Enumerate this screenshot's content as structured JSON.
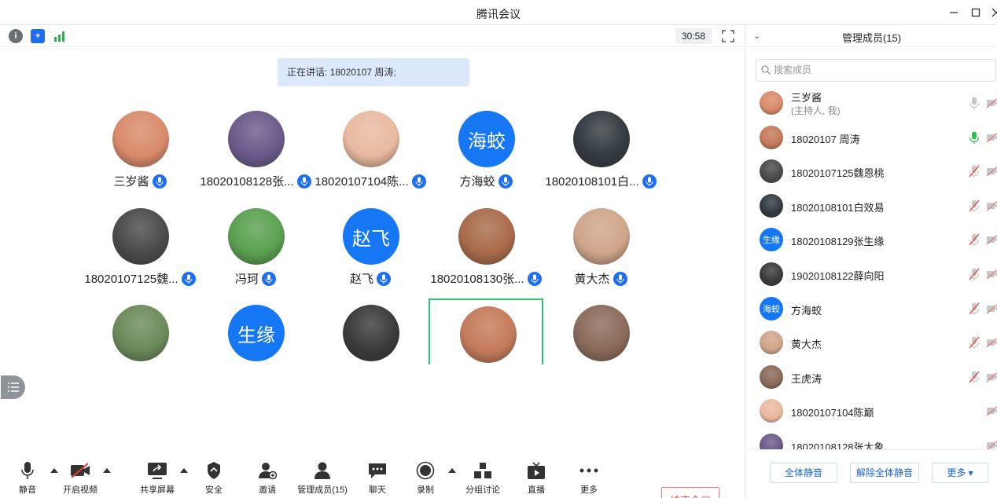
{
  "window": {
    "title": "腾讯会议"
  },
  "topbar": {
    "timer": "30:58"
  },
  "speaking": {
    "text": "正在讲话: 18020107  周涛;"
  },
  "tiles": [
    {
      "name": "三岁酱",
      "avatar": "photo",
      "color": "#d98a6a"
    },
    {
      "name": "18020108128张...",
      "avatar": "photo",
      "color": "#6a5a8a"
    },
    {
      "name": "18020107104陈...",
      "avatar": "photo",
      "color": "#e8b9a0"
    },
    {
      "name": "方海蛟",
      "avatar": "text",
      "avatar_text": "海蛟",
      "color": "#1677f5"
    },
    {
      "name": "18020108101白...",
      "avatar": "photo",
      "color": "#333a3f"
    },
    {
      "name": "18020107125魏...",
      "avatar": "photo",
      "color": "#4a4a4a"
    },
    {
      "name": "冯珂",
      "avatar": "photo",
      "color": "#5aa050"
    },
    {
      "name": "赵飞",
      "avatar": "text",
      "avatar_text": "赵飞",
      "color": "#1677f5"
    },
    {
      "name": "18020108130张...",
      "avatar": "photo",
      "color": "#a86a4a"
    },
    {
      "name": "黄大杰",
      "avatar": "photo",
      "color": "#cfa58a"
    },
    {
      "name": "",
      "avatar": "photo",
      "color": "#6a8a5a"
    },
    {
      "name": "",
      "avatar": "text",
      "avatar_text": "生缘",
      "color": "#1677f5"
    },
    {
      "name": "",
      "avatar": "photo",
      "color": "#3a3a3a"
    },
    {
      "name": "",
      "avatar": "photo",
      "color": "#c47a5a"
    },
    {
      "name": "",
      "avatar": "photo",
      "color": "#8a6a5a"
    }
  ],
  "toolbar": {
    "mute": "静音",
    "video": "开启视频",
    "share": "共享屏幕",
    "security": "安全",
    "invite": "邀请",
    "members": "管理成员(15)",
    "chat": "聊天",
    "record": "录制",
    "breakout": "分组讨论",
    "live": "直播",
    "more": "更多",
    "end": "结束会议"
  },
  "panel": {
    "title": "管理成员(15)",
    "search_placeholder": "搜索成员",
    "members": [
      {
        "name": "三岁酱",
        "sub": "(主持人, 我)",
        "avatar": "photo",
        "color": "#d98a6a",
        "mic": "off-gray"
      },
      {
        "name": "18020107  周涛",
        "avatar": "photo",
        "color": "#c47a5a",
        "mic": "on"
      },
      {
        "name": "18020107125魏恩桃",
        "avatar": "photo",
        "color": "#4a4a4a",
        "mic": "muted"
      },
      {
        "name": "18020108101白效易",
        "avatar": "photo",
        "color": "#333a3f",
        "mic": "muted"
      },
      {
        "name": "18020108129张生缘",
        "avatar": "text",
        "avatar_text": "生缘",
        "color": "#1677f5",
        "mic": "muted"
      },
      {
        "name": "19020108122薛向阳",
        "avatar": "photo",
        "color": "#3a3a3a",
        "mic": "muted"
      },
      {
        "name": "方海蛟",
        "avatar": "text",
        "avatar_text": "海蛟",
        "color": "#1677f5",
        "mic": "muted"
      },
      {
        "name": "黄大杰",
        "avatar": "photo",
        "color": "#cfa58a",
        "mic": "muted"
      },
      {
        "name": "王虎涛",
        "avatar": "photo",
        "color": "#8a6a5a",
        "mic": "muted"
      },
      {
        "name": "18020107104陈巅",
        "avatar": "photo",
        "color": "#e8b9a0",
        "mic": "none"
      },
      {
        "name": "18020108128张大象",
        "avatar": "photo",
        "color": "#6a5a8a",
        "mic": "none"
      }
    ],
    "mute_all": "全体静音",
    "unmute_all": "解除全体静音",
    "more": "更多"
  }
}
